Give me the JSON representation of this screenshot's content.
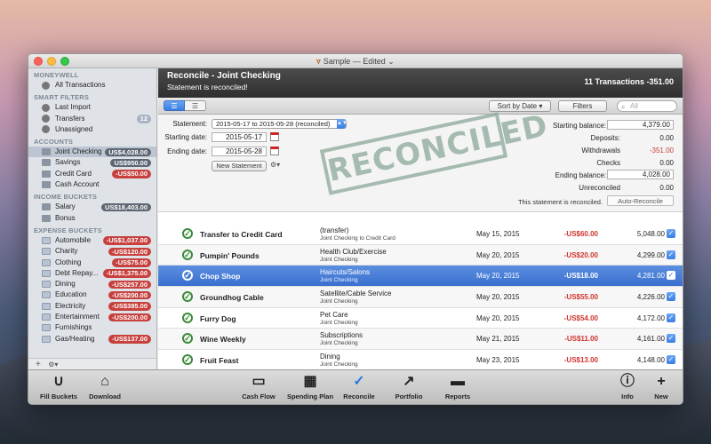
{
  "window": {
    "title": "Sample — Edited",
    "title_arrow": "⌄"
  },
  "sidebar": {
    "sections": [
      {
        "header": "MONEYWELL",
        "items": [
          {
            "label": "All Transactions",
            "kind": "gear",
            "badge": ""
          }
        ]
      },
      {
        "header": "SMART FILTERS",
        "items": [
          {
            "label": "Last Import",
            "kind": "gear",
            "badge": ""
          },
          {
            "label": "Transfers",
            "kind": "gear",
            "badge": "12",
            "badge_style": "light"
          },
          {
            "label": "Unassigned",
            "kind": "gear",
            "badge": ""
          }
        ]
      },
      {
        "header": "ACCOUNTS",
        "items": [
          {
            "label": "Joint Checking",
            "kind": "account",
            "badge": "US$4,028.00",
            "badge_style": "dark",
            "selected": true
          },
          {
            "label": "Savings",
            "kind": "account",
            "badge": "US$950.00",
            "badge_style": "dark"
          },
          {
            "label": "Credit Card",
            "kind": "account",
            "badge": "-US$50.00",
            "badge_style": "red"
          },
          {
            "label": "Cash Account",
            "kind": "account",
            "badge": ""
          }
        ]
      },
      {
        "header": "INCOME BUCKETS",
        "items": [
          {
            "label": "Salary",
            "kind": "income",
            "badge": "US$18,403.00",
            "badge_style": "dark"
          },
          {
            "label": "Bonus",
            "kind": "income",
            "badge": ""
          }
        ]
      },
      {
        "header": "EXPENSE BUCKETS",
        "items": [
          {
            "label": "Automobile",
            "kind": "bucket",
            "badge": "-US$1,037.00",
            "badge_style": "red"
          },
          {
            "label": "Charity",
            "kind": "bucket",
            "badge": "-US$120.00",
            "badge_style": "red"
          },
          {
            "label": "Clothing",
            "kind": "bucket",
            "badge": "-US$75.00",
            "badge_style": "red"
          },
          {
            "label": "Debt Repay...",
            "kind": "bucket",
            "badge": "-US$1,375.00",
            "badge_style": "red"
          },
          {
            "label": "Dining",
            "kind": "bucket",
            "badge": "-US$257.00",
            "badge_style": "red"
          },
          {
            "label": "Education",
            "kind": "bucket",
            "badge": "-US$200.00",
            "badge_style": "red"
          },
          {
            "label": "Electricity",
            "kind": "bucket",
            "badge": "-US$385.00",
            "badge_style": "red"
          },
          {
            "label": "Entertainment",
            "kind": "bucket",
            "badge": "-US$200.00",
            "badge_style": "red"
          },
          {
            "label": "Furnishings",
            "kind": "bucket",
            "badge": ""
          },
          {
            "label": "Gas/Heating",
            "kind": "bucket",
            "badge": "-US$137.00",
            "badge_style": "red"
          }
        ]
      }
    ],
    "footer_add": "+",
    "footer_gear": "⚙▾"
  },
  "header": {
    "title": "Reconcile - Joint Checking",
    "subtitle": "Statement is reconciled!",
    "summary": "11 Transactions -351.00"
  },
  "toolbar": {
    "sort_label": "Sort by Date",
    "filters_label": "Filters",
    "search_placeholder": "All"
  },
  "reconcile": {
    "statement_label": "Statement:",
    "statement_value": "2015-05-17 to 2015-05-28 (reconciled)",
    "starting_date_label": "Starting date:",
    "starting_date": "2015-05-17",
    "ending_date_label": "Ending date:",
    "ending_date": "2015-05-28",
    "new_statement_label": "New Statement",
    "stamp_text": "RECONCILED",
    "starting_balance_label": "Starting balance:",
    "starting_balance": "4,379.00",
    "deposits_label": "Deposits:",
    "deposits": "0.00",
    "withdrawals_label": "Withdrawals",
    "withdrawals": "-351.00",
    "checks_label": "Checks",
    "checks": "0.00",
    "ending_balance_label": "Ending balance:",
    "ending_balance": "4,028.00",
    "unreconciled_label": "Unreconciled",
    "unreconciled": "0.00",
    "note": "This statement is reconciled.",
    "auto_reconcile_label": "Auto-Reconcile"
  },
  "transactions": [
    {
      "payee": "Transfer to Credit Card",
      "category": "(transfer)",
      "account": "Joint Checking to Credit Card",
      "date": "May 15, 2015",
      "amount": "-US$60.00",
      "balance": "5,048.00"
    },
    {
      "payee": "Pumpin' Pounds",
      "category": "Health Club/Exercise",
      "account": "Joint Checking",
      "date": "May 20, 2015",
      "amount": "-US$20.00",
      "balance": "4,299.00"
    },
    {
      "payee": "Chop Shop",
      "category": "Haircuts/Salons",
      "account": "Joint Checking",
      "date": "May 20, 2015",
      "amount": "-US$18.00",
      "balance": "4,281.00",
      "selected": true
    },
    {
      "payee": "Groundhog Cable",
      "category": "Satellite/Cable Service",
      "account": "Joint Checking",
      "date": "May 20, 2015",
      "amount": "-US$55.00",
      "balance": "4,226.00"
    },
    {
      "payee": "Furry Dog",
      "category": "Pet Care",
      "account": "Joint Checking",
      "date": "May 20, 2015",
      "amount": "-US$54.00",
      "balance": "4,172.00"
    },
    {
      "payee": "Wine Weekly",
      "category": "Subscriptions",
      "account": "Joint Checking",
      "date": "May 21, 2015",
      "amount": "-US$11.00",
      "balance": "4,161.00"
    },
    {
      "payee": "Fruit Feast",
      "category": "Dining",
      "account": "Joint Checking",
      "date": "May 23, 2015",
      "amount": "-US$13.00",
      "balance": "4,148.00"
    }
  ],
  "bottom_bar": {
    "fill_buckets": "Fill Buckets",
    "download": "Download",
    "cash_flow": "Cash Flow",
    "spending_plan": "Spending Plan",
    "reconcile": "Reconcile",
    "portfolio": "Portfolio",
    "reports": "Reports",
    "info": "Info",
    "new": "New"
  },
  "colors": {
    "accent": "#3b7ee0",
    "negative": "#d0342f",
    "selected_row": "#3a6fcf"
  }
}
